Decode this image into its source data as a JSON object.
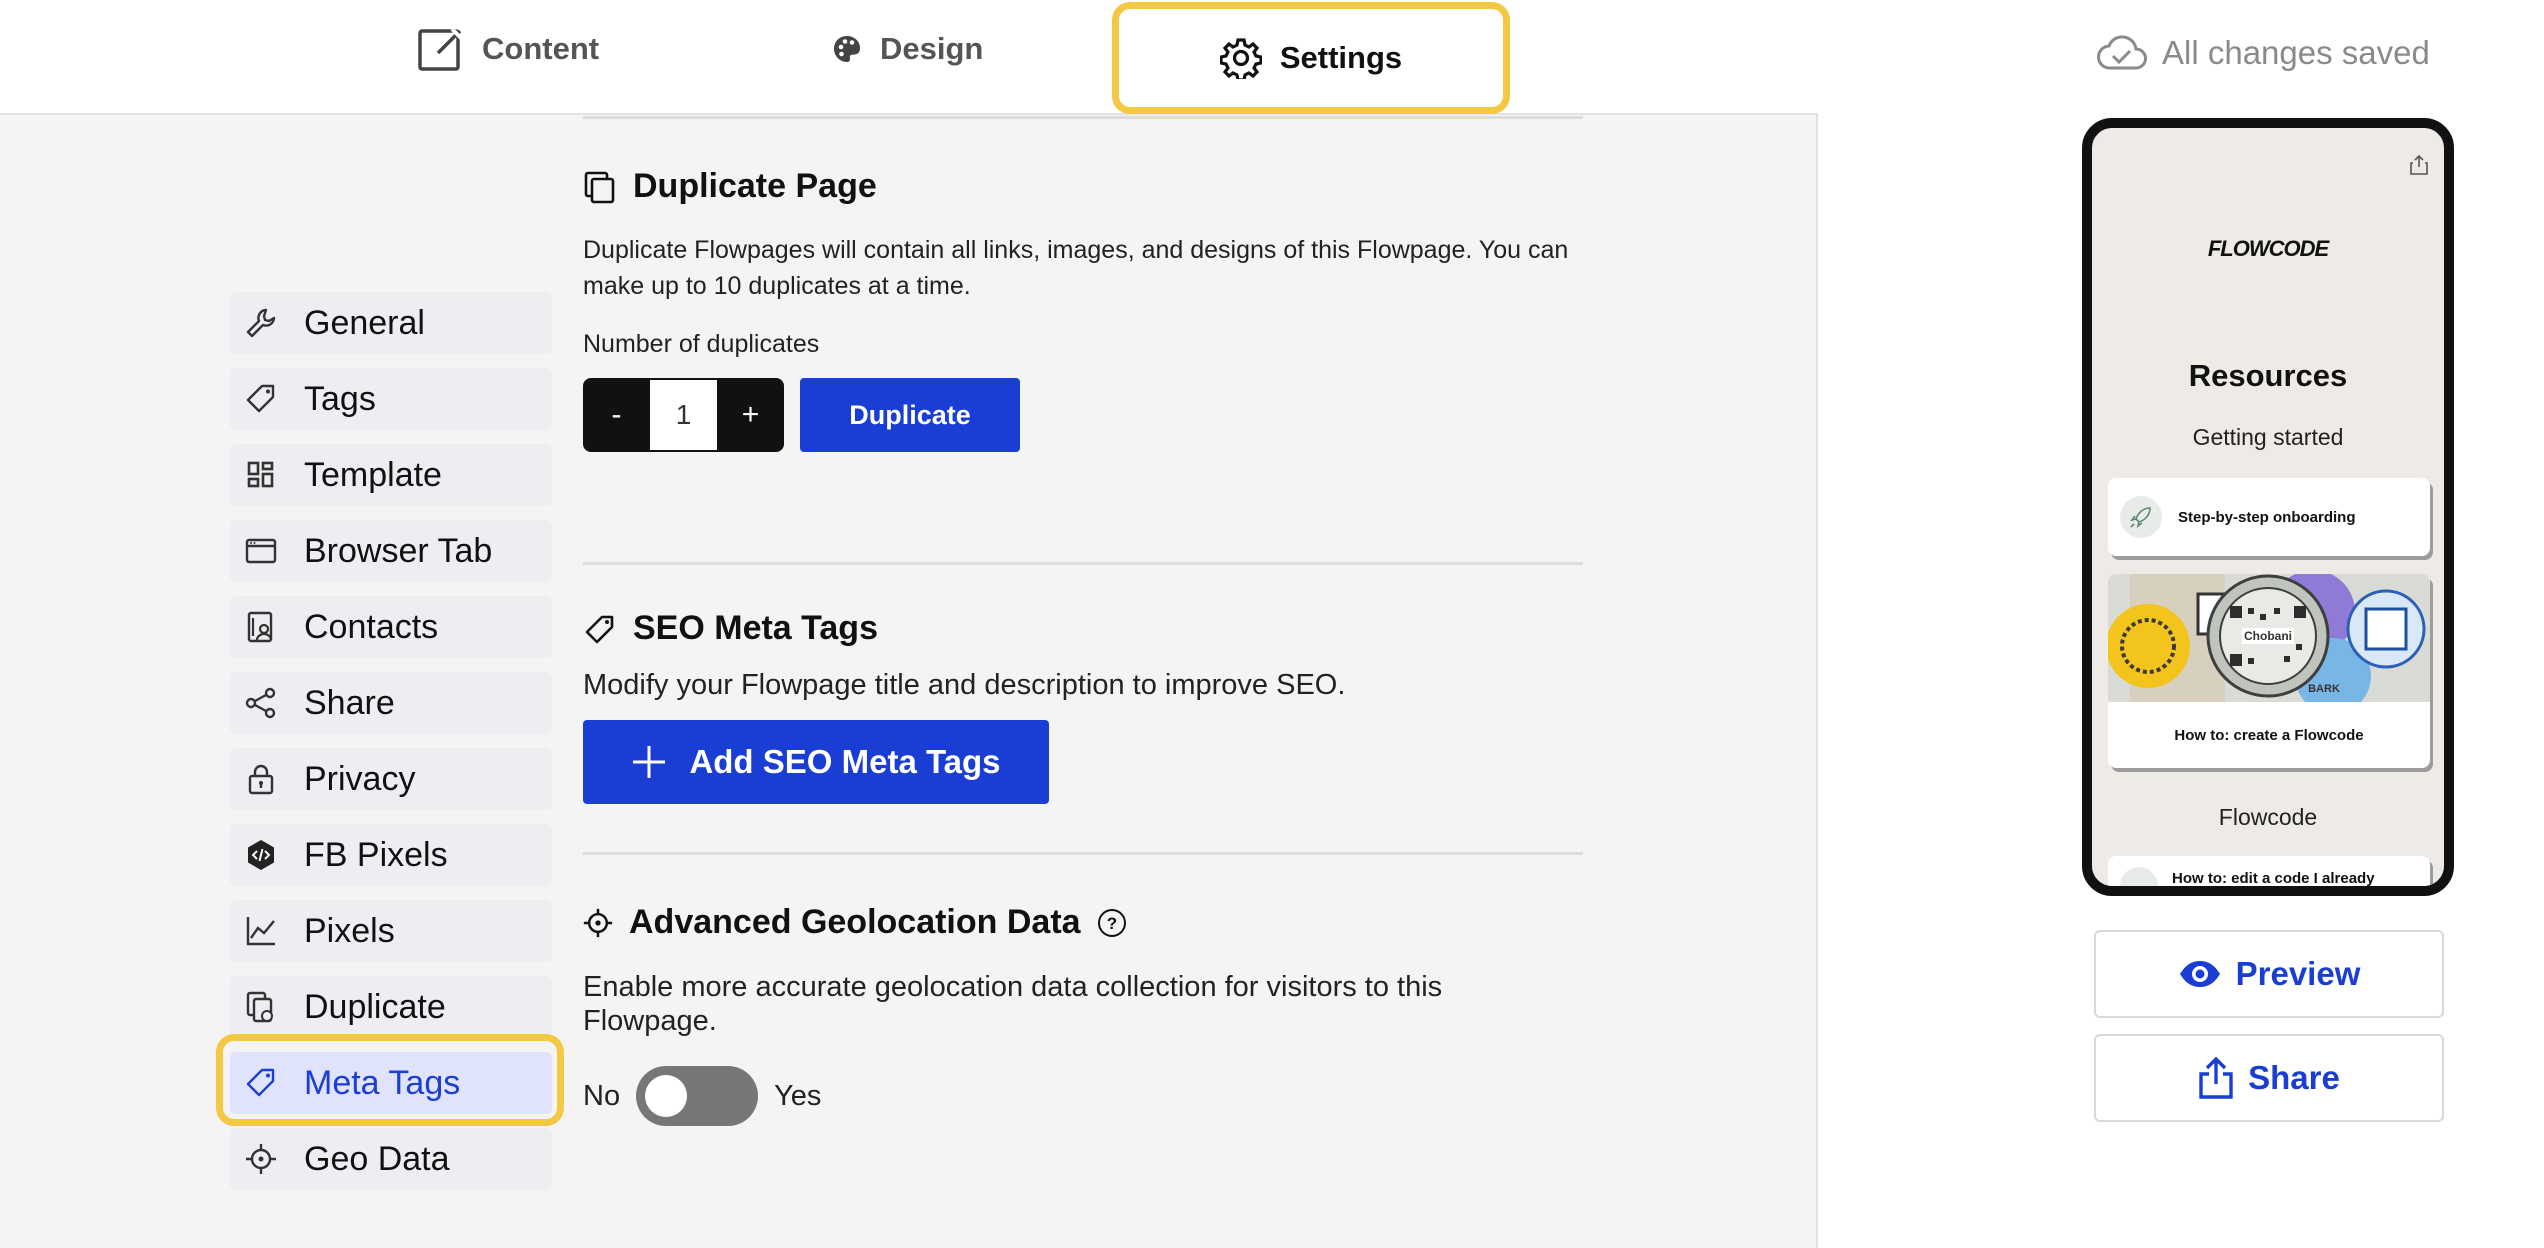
{
  "tabs": {
    "content": "Content",
    "design": "Design",
    "settings": "Settings"
  },
  "sidebar": {
    "items": [
      {
        "label": "General",
        "icon": "wrench-icon"
      },
      {
        "label": "Tags",
        "icon": "tag-icon"
      },
      {
        "label": "Template",
        "icon": "template-icon"
      },
      {
        "label": "Browser Tab",
        "icon": "browser-tab-icon"
      },
      {
        "label": "Contacts",
        "icon": "contacts-icon"
      },
      {
        "label": "Share",
        "icon": "share-icon"
      },
      {
        "label": "Privacy",
        "icon": "lock-icon"
      },
      {
        "label": "FB Pixels",
        "icon": "code-hexagon-icon"
      },
      {
        "label": "Pixels",
        "icon": "line-chart-icon"
      },
      {
        "label": "Duplicate",
        "icon": "duplicate-icon"
      },
      {
        "label": "Meta Tags",
        "icon": "tag-icon",
        "active": true
      },
      {
        "label": "Geo Data",
        "icon": "crosshair-icon"
      }
    ]
  },
  "duplicate": {
    "title": "Duplicate Page",
    "description": "Duplicate Flowpages will contain all links, images, and designs of this Flowpage. You can make up to 10 duplicates at a time.",
    "count_label": "Number of duplicates",
    "minus": "-",
    "value": "1",
    "plus": "+",
    "button": "Duplicate"
  },
  "seo": {
    "title": "SEO Meta Tags",
    "description": "Modify your Flowpage title and description to improve SEO.",
    "button": "Add SEO Meta Tags"
  },
  "geo": {
    "title": "Advanced Geolocation Data",
    "description": "Enable more accurate geolocation data collection for visitors to this Flowpage.",
    "no": "No",
    "yes": "Yes",
    "enabled": false
  },
  "status": {
    "saved": "All changes saved"
  },
  "preview": {
    "logo": "FLOWCODE",
    "title": "Resources",
    "subtitle": "Getting started",
    "link1": "Step-by-step onboarding",
    "card2_caption": "How to: create a Flowcode",
    "card2_image_label": "Chobani",
    "card2_image_label2": "BARK",
    "section2": "Flowcode",
    "link3": "How to: edit a code I already"
  },
  "actions": {
    "preview": "Preview",
    "share": "Share"
  },
  "colors": {
    "accent": "#1a3ed4",
    "highlight": "#f3c843",
    "sidebar_active_bg": "#dfe3fb",
    "toggle_off": "#777777"
  }
}
